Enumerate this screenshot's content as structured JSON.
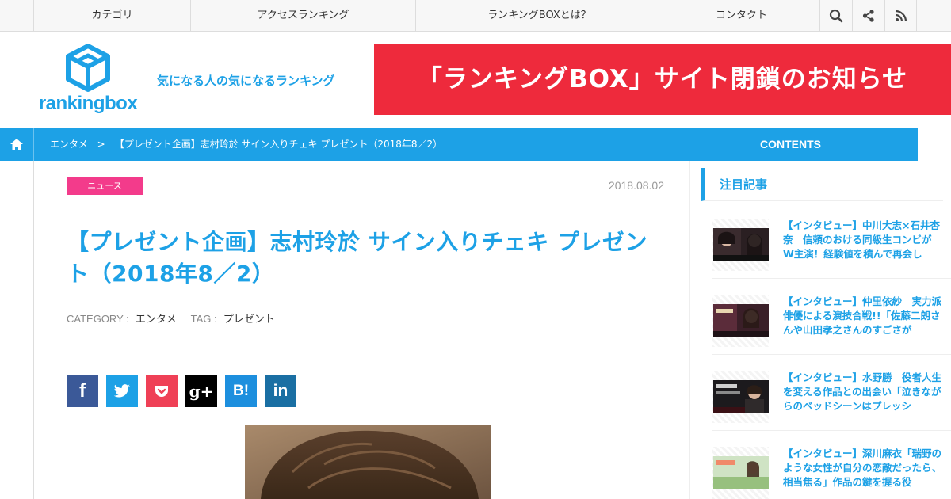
{
  "nav": {
    "items": [
      "カテゴリ",
      "アクセスランキング",
      "ランキングBOXとは？",
      "コンタクト"
    ],
    "icons": [
      "search-icon",
      "share-icon",
      "rss-icon"
    ]
  },
  "header": {
    "logo_text": "rankingbox",
    "tagline": "気になる人の気になるランキング",
    "banner_text": "「ランキングBOX」サイト閉鎖のお知らせ"
  },
  "breadcrumb": {
    "category": "エンタメ",
    "current": "【プレゼント企画】志村玲於 サイン入りチェキ プレゼント（2018年8／2）",
    "separator": ">",
    "contents_label": "CONTENTS"
  },
  "article": {
    "badge": "ニュース",
    "date": "2018.08.02",
    "title": "【プレゼント企画】志村玲於 サイン入りチェキ プレゼント（2018年8／2）",
    "category_label": "CATEGORY :",
    "category": "エンタメ",
    "tag_label": "TAG :",
    "tag": "プレゼント",
    "share": [
      {
        "name": "facebook-share-button",
        "glyph": "f",
        "color": "#3b5998"
      },
      {
        "name": "twitter-share-button",
        "glyph": "🐦",
        "color": "#1da1e6"
      },
      {
        "name": "pocket-share-button",
        "glyph": "❤",
        "color": "#ef4056"
      },
      {
        "name": "googleplus-share-button",
        "glyph": "g+",
        "color": "#000000"
      },
      {
        "name": "hatena-share-button",
        "glyph": "B!",
        "color": "#1d8fde"
      },
      {
        "name": "linkedin-share-button",
        "glyph": "in",
        "color": "#1a6fa3"
      }
    ]
  },
  "sidebar": {
    "heading": "注目記事",
    "items": [
      {
        "title": "【インタビュー】中川大志×石井杏奈　信頼のおける同級生コンビがW主演！経験値を積んで再会し"
      },
      {
        "title": "【インタビュー】仲里依紗　実力派俳優による演技合戦!!「佐藤二朗さんや山田孝之さんのすごさが"
      },
      {
        "title": "【インタビュー】水野勝　役者人生を変える作品との出会い「泣きながらのベッドシーンはプレッシ"
      },
      {
        "title": "【インタビュー】深川麻衣「瑞野のような女性が自分の恋敵だったら、相当焦る」作品の鍵を握る役"
      }
    ]
  },
  "colors": {
    "accent": "#1da1e6",
    "banner": "#ee2a3c",
    "badge": "#f33b8b"
  }
}
